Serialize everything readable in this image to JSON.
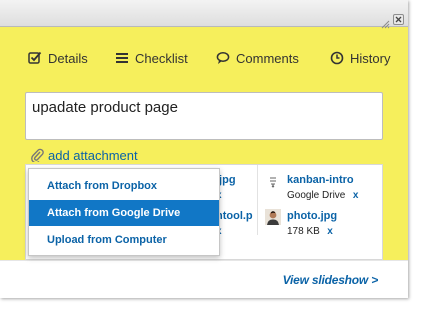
{
  "tabs": [
    {
      "label": "Details",
      "icon": "checkbox-check-icon"
    },
    {
      "label": "Checklist",
      "icon": "list-lines-icon"
    },
    {
      "label": "Comments",
      "icon": "speech-bubble-icon"
    },
    {
      "label": "History",
      "icon": "clock-icon"
    }
  ],
  "title_field": {
    "value": "upadate product page"
  },
  "attachments": {
    "link_label": "add attachment",
    "files": [
      {
        "name": ".jpg",
        "meta": "",
        "remove": "x"
      },
      {
        "name": "ntool.p",
        "meta": "",
        "remove": "x"
      },
      {
        "name": "kanban-intro",
        "meta": "Google Drive",
        "remove": "x"
      },
      {
        "name": "photo.jpg",
        "meta": "178 KB",
        "remove": "x"
      }
    ]
  },
  "dropdown": {
    "items": [
      {
        "label": "Attach from Dropbox",
        "selected": false
      },
      {
        "label": "Attach from Google Drive",
        "selected": true
      },
      {
        "label": "Upload from Computer",
        "selected": false
      }
    ]
  },
  "footer": {
    "slideshow_label": "View slideshow >"
  },
  "colors": {
    "card_background": "#f6ef5c",
    "link": "#0b63a7",
    "highlight": "#1177c6"
  }
}
